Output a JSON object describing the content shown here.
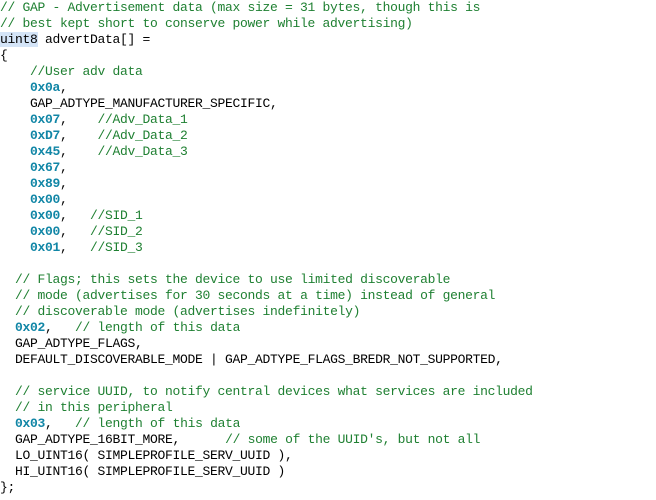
{
  "editor": {
    "language": "c",
    "background_color": "#ffffff",
    "comment_color": "#1f8032",
    "number_color": "#1186a6",
    "text_color": "#000000",
    "highlight_color": "#d4e4f7",
    "line_height_px": 16,
    "font_size_px": 13
  },
  "code": {
    "lines": [
      {
        "indent": 0,
        "tokens": [
          {
            "type": "comment",
            "text": "// GAP - Advertisement data (max size = 31 bytes, though this is"
          }
        ]
      },
      {
        "indent": 0,
        "tokens": [
          {
            "type": "comment",
            "text": "// best kept short to conserve power while advertising)"
          }
        ]
      },
      {
        "indent": 0,
        "tokens": [
          {
            "type": "kw-hl",
            "text": "uint8"
          },
          {
            "type": "plain",
            "text": " advertData[] ="
          }
        ]
      },
      {
        "indent": 0,
        "tokens": [
          {
            "type": "plain",
            "text": "{"
          }
        ]
      },
      {
        "indent": 4,
        "tokens": [
          {
            "type": "comment",
            "text": "//User adv data"
          }
        ]
      },
      {
        "indent": 4,
        "tokens": [
          {
            "type": "num",
            "text": "0x0a"
          },
          {
            "type": "plain",
            "text": ","
          }
        ]
      },
      {
        "indent": 4,
        "tokens": [
          {
            "type": "plain",
            "text": "GAP_ADTYPE_MANUFACTURER_SPECIFIC,"
          }
        ]
      },
      {
        "indent": 4,
        "tokens": [
          {
            "type": "num",
            "text": "0x07"
          },
          {
            "type": "plain",
            "text": ",    "
          },
          {
            "type": "comment",
            "text": "//Adv_Data_1"
          }
        ]
      },
      {
        "indent": 4,
        "tokens": [
          {
            "type": "num",
            "text": "0xD7"
          },
          {
            "type": "plain",
            "text": ",    "
          },
          {
            "type": "comment",
            "text": "//Adv_Data_2"
          }
        ]
      },
      {
        "indent": 4,
        "tokens": [
          {
            "type": "num",
            "text": "0x45"
          },
          {
            "type": "plain",
            "text": ",    "
          },
          {
            "type": "comment",
            "text": "//Adv_Data_3"
          }
        ]
      },
      {
        "indent": 4,
        "tokens": [
          {
            "type": "num",
            "text": "0x67"
          },
          {
            "type": "plain",
            "text": ","
          }
        ]
      },
      {
        "indent": 4,
        "tokens": [
          {
            "type": "num",
            "text": "0x89"
          },
          {
            "type": "plain",
            "text": ","
          }
        ]
      },
      {
        "indent": 4,
        "tokens": [
          {
            "type": "num",
            "text": "0x00"
          },
          {
            "type": "plain",
            "text": ","
          }
        ]
      },
      {
        "indent": 4,
        "tokens": [
          {
            "type": "num",
            "text": "0x00"
          },
          {
            "type": "plain",
            "text": ",   "
          },
          {
            "type": "comment",
            "text": "//SID_1"
          }
        ]
      },
      {
        "indent": 4,
        "tokens": [
          {
            "type": "num",
            "text": "0x00"
          },
          {
            "type": "plain",
            "text": ",   "
          },
          {
            "type": "comment",
            "text": "//SID_2"
          }
        ]
      },
      {
        "indent": 4,
        "tokens": [
          {
            "type": "num",
            "text": "0x01"
          },
          {
            "type": "plain",
            "text": ",   "
          },
          {
            "type": "comment",
            "text": "//SID_3"
          }
        ]
      },
      {
        "indent": 0,
        "tokens": []
      },
      {
        "indent": 2,
        "tokens": [
          {
            "type": "comment",
            "text": "// Flags; this sets the device to use limited discoverable"
          }
        ]
      },
      {
        "indent": 2,
        "tokens": [
          {
            "type": "comment",
            "text": "// mode (advertises for 30 seconds at a time) instead of general"
          }
        ]
      },
      {
        "indent": 2,
        "tokens": [
          {
            "type": "comment",
            "text": "// discoverable mode (advertises indefinitely)"
          }
        ]
      },
      {
        "indent": 2,
        "tokens": [
          {
            "type": "num",
            "text": "0x02"
          },
          {
            "type": "plain",
            "text": ",   "
          },
          {
            "type": "comment",
            "text": "// length of this data"
          }
        ]
      },
      {
        "indent": 2,
        "tokens": [
          {
            "type": "plain",
            "text": "GAP_ADTYPE_FLAGS,"
          }
        ]
      },
      {
        "indent": 2,
        "tokens": [
          {
            "type": "plain",
            "text": "DEFAULT_DISCOVERABLE_MODE | GAP_ADTYPE_FLAGS_BREDR_NOT_SUPPORTED,"
          }
        ]
      },
      {
        "indent": 0,
        "tokens": []
      },
      {
        "indent": 2,
        "tokens": [
          {
            "type": "comment",
            "text": "// service UUID, to notify central devices what services are included"
          }
        ]
      },
      {
        "indent": 2,
        "tokens": [
          {
            "type": "comment",
            "text": "// in this peripheral"
          }
        ]
      },
      {
        "indent": 2,
        "tokens": [
          {
            "type": "num",
            "text": "0x03"
          },
          {
            "type": "plain",
            "text": ",   "
          },
          {
            "type": "comment",
            "text": "// length of this data"
          }
        ]
      },
      {
        "indent": 2,
        "tokens": [
          {
            "type": "plain",
            "text": "GAP_ADTYPE_16BIT_MORE,"
          },
          {
            "type": "plain",
            "text": "      "
          },
          {
            "type": "comment",
            "text": "// some of the UUID's, but not all"
          }
        ]
      },
      {
        "indent": 2,
        "tokens": [
          {
            "type": "plain",
            "text": "LO_UINT16( SIMPLEPROFILE_SERV_UUID ),"
          }
        ]
      },
      {
        "indent": 2,
        "tokens": [
          {
            "type": "plain",
            "text": "HI_UINT16( SIMPLEPROFILE_SERV_UUID )"
          }
        ]
      },
      {
        "indent": 0,
        "tokens": [
          {
            "type": "plain",
            "text": "};"
          }
        ]
      }
    ]
  }
}
